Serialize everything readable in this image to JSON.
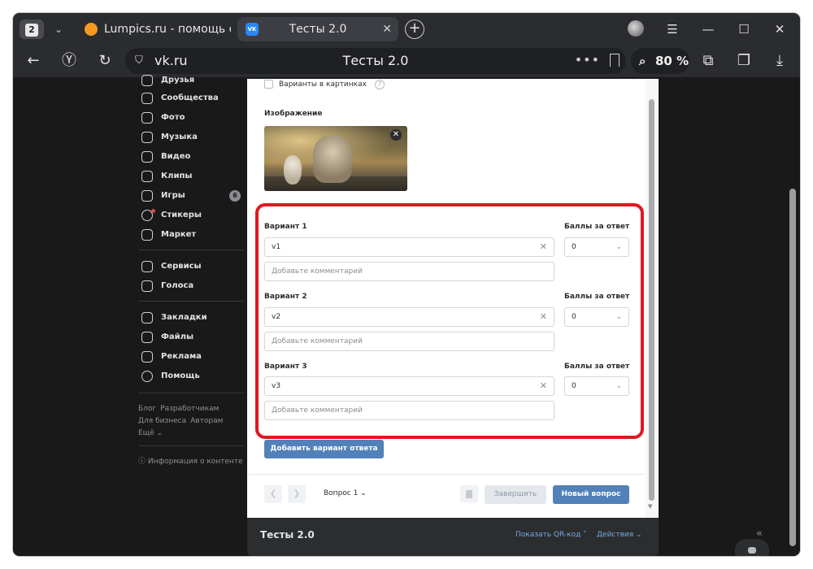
{
  "browser": {
    "tab_count": "2",
    "tabs": [
      {
        "title": "Lumpics.ru - помощь с ко",
        "active": false
      },
      {
        "title": "Тесты 2.0",
        "active": true
      }
    ],
    "url": "vk.ru",
    "page_title": "Тесты 2.0",
    "zoom": "80 %",
    "icons": {
      "back": "back-arrow-icon",
      "yandex": "yandex-icon",
      "reload": "reload-icon",
      "shield": "shield-icon",
      "bookmark": "bookmark-icon",
      "extensions": "puzzle-icon",
      "download": "download-icon"
    }
  },
  "sidebar": {
    "items": [
      {
        "label": "Друзья"
      },
      {
        "label": "Сообщества"
      },
      {
        "label": "Фото"
      },
      {
        "label": "Музыка"
      },
      {
        "label": "Видео"
      },
      {
        "label": "Клипы"
      },
      {
        "label": "Игры",
        "badge": "6"
      },
      {
        "label": "Стикеры"
      },
      {
        "label": "Маркет"
      },
      {
        "label": "Сервисы"
      },
      {
        "label": "Голоса"
      },
      {
        "label": "Закладки"
      },
      {
        "label": "Файлы"
      },
      {
        "label": "Реклама"
      },
      {
        "label": "Помощь"
      }
    ],
    "footer_links": [
      "Блог",
      "Разработчикам",
      "Для бизнеса",
      "Авторам",
      "Ещё ⌄"
    ],
    "info": "ⓘ Информация о контенте"
  },
  "editor": {
    "pictures_option": "Варианты в картинках",
    "image_label": "Изображение",
    "options": [
      {
        "label": "Вариант 1",
        "value": "v1",
        "comment_placeholder": "Добавьте комментарий",
        "points_label": "Баллы за ответ",
        "points": "0"
      },
      {
        "label": "Вариант 2",
        "value": "v2",
        "comment_placeholder": "Добавьте комментарий",
        "points_label": "Баллы за ответ",
        "points": "0"
      },
      {
        "label": "Вариант 3",
        "value": "v3",
        "comment_placeholder": "Добавьте комментарий",
        "points_label": "Баллы за ответ",
        "points": "0"
      }
    ],
    "add_option": "Добавить вариант ответа",
    "question_selector": "Вопрос 1 ⌄",
    "finish": "Завершить",
    "new_question": "Новый вопрос"
  },
  "bottom_bar": {
    "title": "Тесты 2.0",
    "qr_link": "Показать QR-код ˅",
    "actions_link": "Действия ⌄"
  },
  "colors": {
    "accent": "#5181b8",
    "highlight": "#e0171f",
    "dark_bg": "#19191a"
  }
}
